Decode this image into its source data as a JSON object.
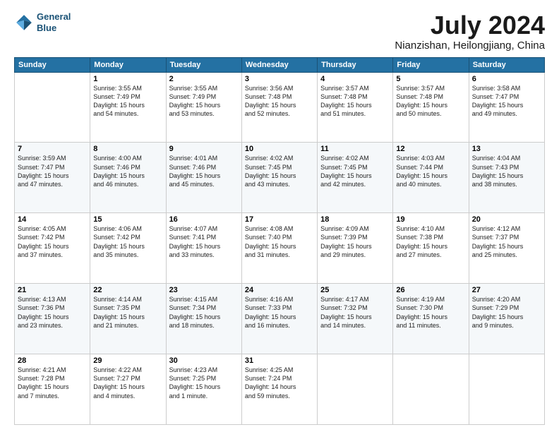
{
  "header": {
    "logo_line1": "General",
    "logo_line2": "Blue",
    "month": "July 2024",
    "location": "Nianzishan, Heilongjiang, China"
  },
  "weekdays": [
    "Sunday",
    "Monday",
    "Tuesday",
    "Wednesday",
    "Thursday",
    "Friday",
    "Saturday"
  ],
  "weeks": [
    [
      {
        "day": "",
        "text": ""
      },
      {
        "day": "1",
        "text": "Sunrise: 3:55 AM\nSunset: 7:49 PM\nDaylight: 15 hours\nand 54 minutes."
      },
      {
        "day": "2",
        "text": "Sunrise: 3:55 AM\nSunset: 7:49 PM\nDaylight: 15 hours\nand 53 minutes."
      },
      {
        "day": "3",
        "text": "Sunrise: 3:56 AM\nSunset: 7:48 PM\nDaylight: 15 hours\nand 52 minutes."
      },
      {
        "day": "4",
        "text": "Sunrise: 3:57 AM\nSunset: 7:48 PM\nDaylight: 15 hours\nand 51 minutes."
      },
      {
        "day": "5",
        "text": "Sunrise: 3:57 AM\nSunset: 7:48 PM\nDaylight: 15 hours\nand 50 minutes."
      },
      {
        "day": "6",
        "text": "Sunrise: 3:58 AM\nSunset: 7:47 PM\nDaylight: 15 hours\nand 49 minutes."
      }
    ],
    [
      {
        "day": "7",
        "text": "Sunrise: 3:59 AM\nSunset: 7:47 PM\nDaylight: 15 hours\nand 47 minutes."
      },
      {
        "day": "8",
        "text": "Sunrise: 4:00 AM\nSunset: 7:46 PM\nDaylight: 15 hours\nand 46 minutes."
      },
      {
        "day": "9",
        "text": "Sunrise: 4:01 AM\nSunset: 7:46 PM\nDaylight: 15 hours\nand 45 minutes."
      },
      {
        "day": "10",
        "text": "Sunrise: 4:02 AM\nSunset: 7:45 PM\nDaylight: 15 hours\nand 43 minutes."
      },
      {
        "day": "11",
        "text": "Sunrise: 4:02 AM\nSunset: 7:45 PM\nDaylight: 15 hours\nand 42 minutes."
      },
      {
        "day": "12",
        "text": "Sunrise: 4:03 AM\nSunset: 7:44 PM\nDaylight: 15 hours\nand 40 minutes."
      },
      {
        "day": "13",
        "text": "Sunrise: 4:04 AM\nSunset: 7:43 PM\nDaylight: 15 hours\nand 38 minutes."
      }
    ],
    [
      {
        "day": "14",
        "text": "Sunrise: 4:05 AM\nSunset: 7:42 PM\nDaylight: 15 hours\nand 37 minutes."
      },
      {
        "day": "15",
        "text": "Sunrise: 4:06 AM\nSunset: 7:42 PM\nDaylight: 15 hours\nand 35 minutes."
      },
      {
        "day": "16",
        "text": "Sunrise: 4:07 AM\nSunset: 7:41 PM\nDaylight: 15 hours\nand 33 minutes."
      },
      {
        "day": "17",
        "text": "Sunrise: 4:08 AM\nSunset: 7:40 PM\nDaylight: 15 hours\nand 31 minutes."
      },
      {
        "day": "18",
        "text": "Sunrise: 4:09 AM\nSunset: 7:39 PM\nDaylight: 15 hours\nand 29 minutes."
      },
      {
        "day": "19",
        "text": "Sunrise: 4:10 AM\nSunset: 7:38 PM\nDaylight: 15 hours\nand 27 minutes."
      },
      {
        "day": "20",
        "text": "Sunrise: 4:12 AM\nSunset: 7:37 PM\nDaylight: 15 hours\nand 25 minutes."
      }
    ],
    [
      {
        "day": "21",
        "text": "Sunrise: 4:13 AM\nSunset: 7:36 PM\nDaylight: 15 hours\nand 23 minutes."
      },
      {
        "day": "22",
        "text": "Sunrise: 4:14 AM\nSunset: 7:35 PM\nDaylight: 15 hours\nand 21 minutes."
      },
      {
        "day": "23",
        "text": "Sunrise: 4:15 AM\nSunset: 7:34 PM\nDaylight: 15 hours\nand 18 minutes."
      },
      {
        "day": "24",
        "text": "Sunrise: 4:16 AM\nSunset: 7:33 PM\nDaylight: 15 hours\nand 16 minutes."
      },
      {
        "day": "25",
        "text": "Sunrise: 4:17 AM\nSunset: 7:32 PM\nDaylight: 15 hours\nand 14 minutes."
      },
      {
        "day": "26",
        "text": "Sunrise: 4:19 AM\nSunset: 7:30 PM\nDaylight: 15 hours\nand 11 minutes."
      },
      {
        "day": "27",
        "text": "Sunrise: 4:20 AM\nSunset: 7:29 PM\nDaylight: 15 hours\nand 9 minutes."
      }
    ],
    [
      {
        "day": "28",
        "text": "Sunrise: 4:21 AM\nSunset: 7:28 PM\nDaylight: 15 hours\nand 7 minutes."
      },
      {
        "day": "29",
        "text": "Sunrise: 4:22 AM\nSunset: 7:27 PM\nDaylight: 15 hours\nand 4 minutes."
      },
      {
        "day": "30",
        "text": "Sunrise: 4:23 AM\nSunset: 7:25 PM\nDaylight: 15 hours\nand 1 minute."
      },
      {
        "day": "31",
        "text": "Sunrise: 4:25 AM\nSunset: 7:24 PM\nDaylight: 14 hours\nand 59 minutes."
      },
      {
        "day": "",
        "text": ""
      },
      {
        "day": "",
        "text": ""
      },
      {
        "day": "",
        "text": ""
      }
    ]
  ]
}
